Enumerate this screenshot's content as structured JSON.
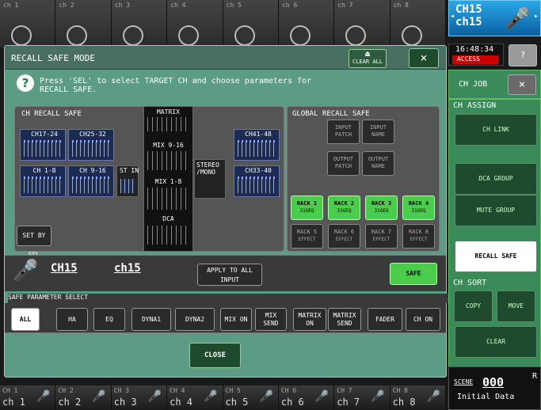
{
  "top_strip": {
    "channels": [
      {
        "label": "ch 1"
      },
      {
        "label": "ch 2"
      },
      {
        "label": "ch 3"
      },
      {
        "label": "ch 4"
      },
      {
        "label": "ch 5"
      },
      {
        "label": "ch 6"
      },
      {
        "label": "ch 7"
      },
      {
        "label": "ch 8"
      }
    ]
  },
  "bottom_strip": {
    "channels": [
      {
        "num": "CH 1",
        "name": "ch 1"
      },
      {
        "num": "CH 2",
        "name": "ch 2"
      },
      {
        "num": "CH 3",
        "name": "ch 3"
      },
      {
        "num": "CH 4",
        "name": "ch 4"
      },
      {
        "num": "CH 5",
        "name": "ch 5"
      },
      {
        "num": "CH 6",
        "name": "ch 6"
      },
      {
        "num": "CH 7",
        "name": "ch 7"
      },
      {
        "num": "CH 8",
        "name": "ch 8"
      }
    ]
  },
  "dialog": {
    "title": "RECALL SAFE MODE",
    "clear_all": "CLEAR ALL",
    "close_x": "×",
    "help_icon": "?",
    "instruction": "Press 'SEL' to select TARGET CH and choose parameters for RECALL SAFE.",
    "ch_recall_safe": {
      "title": "CH RECALL SAFE",
      "groups": [
        "CH17-24",
        "CH25-32",
        "CH 1-8",
        "CH 9-16",
        "ST IN",
        "CH41-48",
        "CH33-40"
      ],
      "stereo_mono": "STEREO /MONO",
      "set_by_sel": "SET BY SEL"
    },
    "matrix": {
      "title": "MATRIX",
      "mix916": "MIX 9-16",
      "mix18": "MIX 1-8",
      "dca": "DCA"
    },
    "global_recall_safe": {
      "title": "GLOBAL RECALL SAFE",
      "input_patch": "INPUT PATCH",
      "input_name": "INPUT NAME",
      "output_patch": "OUTPUT PATCH",
      "output_name": "OUTPUT NAME",
      "racks": [
        {
          "name": "RACK 1",
          "sub": "31GEQ"
        },
        {
          "name": "RACK 2",
          "sub": "31GEQ"
        },
        {
          "name": "RACK 3",
          "sub": "31GEQ"
        },
        {
          "name": "RACK 4",
          "sub": "31GEQ"
        },
        {
          "name": "RACK 5",
          "sub": "EFFECT"
        },
        {
          "name": "RACK 6",
          "sub": "EFFECT"
        },
        {
          "name": "RACK 7",
          "sub": "EFFECT"
        },
        {
          "name": "RACK 8",
          "sub": "EFFECT"
        }
      ]
    },
    "channel": {
      "num": "CH15",
      "name": "ch15",
      "apply_all": "APPLY TO ALL INPUT",
      "safe": "SAFE"
    },
    "safe_param_select": "SAFE PARAMETER SELECT",
    "params": [
      "ALL",
      "HA",
      "EQ",
      "DYNA1",
      "DYNA2",
      "MIX ON",
      "MIX SEND",
      "MATRIX ON",
      "MATRIX SEND",
      "FADER",
      "CH ON"
    ],
    "close": "CLOSE"
  },
  "sidebar": {
    "ch_num": "CH15",
    "ch_name": "ch15",
    "time": "16:48:34",
    "access": "ACCESS",
    "help": "?",
    "ch_job": "CH JOB",
    "ch_job_close": "×",
    "ch_assign": "CH ASSIGN",
    "ch_link": "CH LINK",
    "dca_group": "DCA GROUP",
    "mute_group": "MUTE GROUP",
    "recall_safe": "RECALL SAFE",
    "ch_sort": "CH SORT",
    "copy": "COPY",
    "move": "MOVE",
    "clear": "CLEAR",
    "scene_label": "SCENE",
    "scene_num": "000",
    "scene_r": "R",
    "scene_title": "Initial Data"
  }
}
